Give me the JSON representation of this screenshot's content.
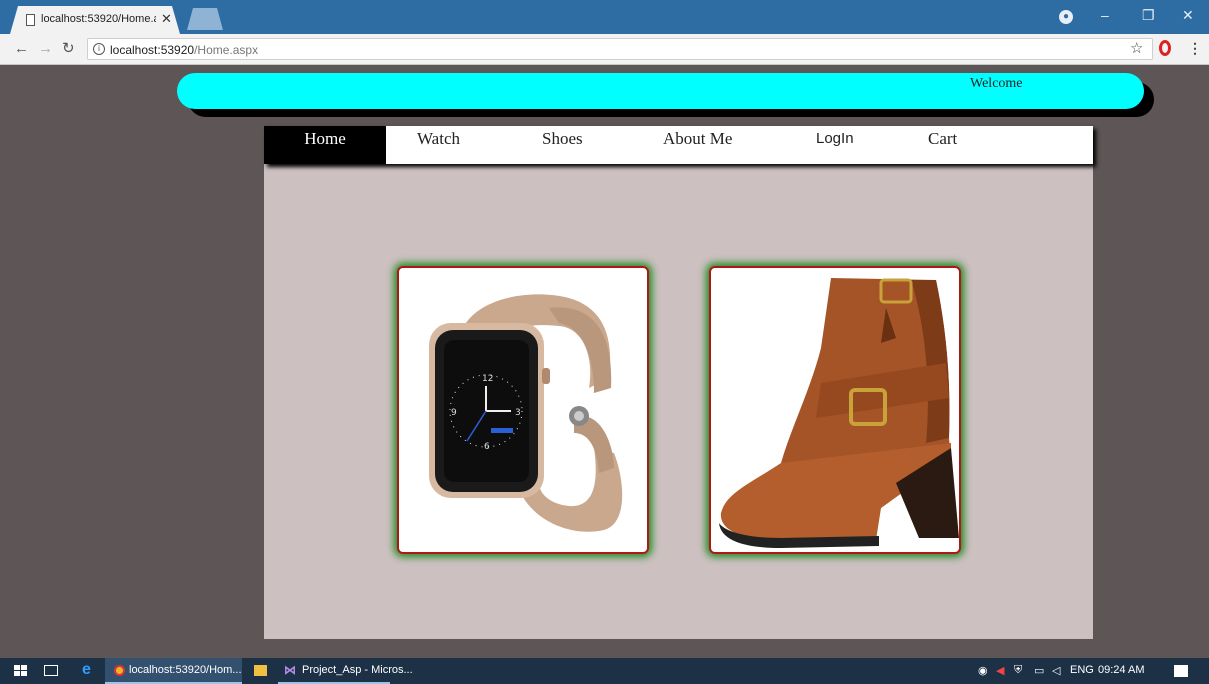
{
  "browser": {
    "tab_title": "localhost:53920/Home.aspx",
    "url_host": "localhost:53920",
    "url_path": "/Home.aspx"
  },
  "site": {
    "welcome_text": "Welcome",
    "nav": [
      "Home",
      "Watch",
      "Shoes",
      "About Me",
      "LogIn",
      "Cart"
    ],
    "active_nav": "Home",
    "products": [
      {
        "name": "smartwatch-image"
      },
      {
        "name": "ankle-boot-image"
      }
    ]
  },
  "taskbar": {
    "chrome_label": "localhost:53920/Hom...",
    "vs_label": "Project_Asp - Micros...",
    "language": "ENG",
    "time": "09:24 AM"
  },
  "colors": {
    "banner": "#00ffff",
    "page_bg": "#5d5556",
    "content_bg": "#cdc0c1",
    "card_border": "#b01818",
    "card_glow": "#1f8a1f"
  }
}
